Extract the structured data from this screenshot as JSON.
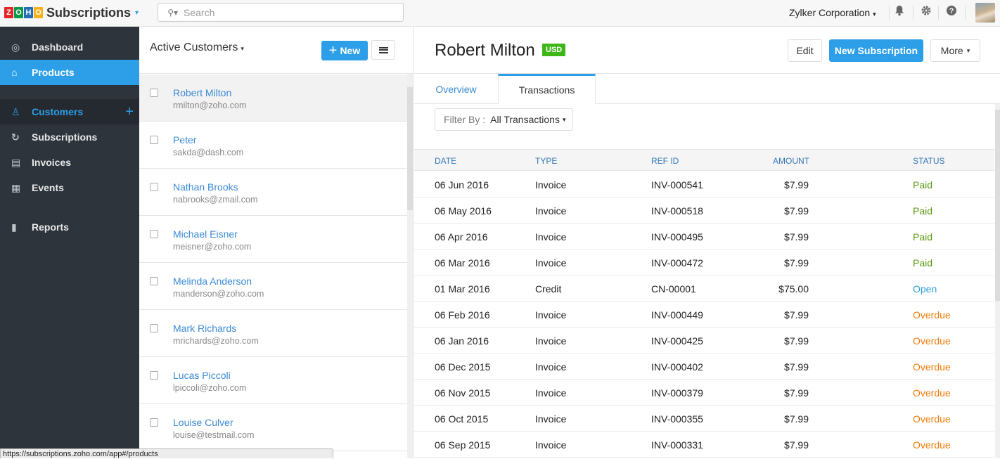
{
  "app": {
    "brand_letters": [
      "Z",
      "O",
      "H",
      "O"
    ],
    "brand_colors": [
      "#e42527",
      "#089949",
      "#226db4",
      "#f9b21d"
    ],
    "name": "Subscriptions",
    "caret": "▾"
  },
  "search": {
    "placeholder": "Search",
    "icon": "search-icon"
  },
  "topbar": {
    "organization": "Zylker Corporation",
    "caret": "▾",
    "icons": {
      "bell": "🔔",
      "gear": "⚙",
      "help": "?"
    }
  },
  "sidebar": {
    "items": [
      {
        "label": "Dashboard",
        "icon": "◎"
      },
      {
        "label": "Products",
        "icon": "⌂"
      },
      {
        "label": "Customers",
        "icon": "♙",
        "action": "+"
      },
      {
        "label": "Subscriptions",
        "icon": "↻"
      },
      {
        "label": "Invoices",
        "icon": "▤"
      },
      {
        "label": "Events",
        "icon": "▦"
      },
      {
        "label": "Reports",
        "icon": "▮"
      }
    ]
  },
  "customer_list": {
    "title": "Active Customers",
    "caret": "▾",
    "new_label": "New",
    "new_icon": "+",
    "customers": [
      {
        "name": "Robert Milton",
        "email": "rmilton@zoho.com"
      },
      {
        "name": "Peter",
        "email": "sakda@dash.com"
      },
      {
        "name": "Nathan Brooks",
        "email": "nabrooks@zmail.com"
      },
      {
        "name": "Michael Eisner",
        "email": "meisner@zoho.com"
      },
      {
        "name": "Melinda Anderson",
        "email": "manderson@zoho.com"
      },
      {
        "name": "Mark Richards",
        "email": "mrichards@zoho.com"
      },
      {
        "name": "Lucas Piccoli",
        "email": "lpiccoli@zoho.com"
      },
      {
        "name": "Louise Culver",
        "email": "louise@testmail.com"
      }
    ]
  },
  "detail": {
    "customer_name": "Robert Milton",
    "currency_badge": "USD",
    "buttons": {
      "edit": "Edit",
      "new_subscription": "New Subscription",
      "more": "More",
      "caret": "▾"
    },
    "tabs": [
      {
        "label": "Overview"
      },
      {
        "label": "Transactions"
      }
    ],
    "filter": {
      "label": "Filter By :",
      "value": "All Transactions",
      "caret": "▾"
    },
    "table": {
      "columns": [
        "DATE",
        "TYPE",
        "REF ID",
        "AMOUNT",
        "STATUS"
      ],
      "rows": [
        {
          "date": "06 Jun 2016",
          "type": "Invoice",
          "ref": "INV-000541",
          "amount": "$7.99",
          "status": "Paid"
        },
        {
          "date": "06 May 2016",
          "type": "Invoice",
          "ref": "INV-000518",
          "amount": "$7.99",
          "status": "Paid"
        },
        {
          "date": "06 Apr 2016",
          "type": "Invoice",
          "ref": "INV-000495",
          "amount": "$7.99",
          "status": "Paid"
        },
        {
          "date": "06 Mar 2016",
          "type": "Invoice",
          "ref": "INV-000472",
          "amount": "$7.99",
          "status": "Paid"
        },
        {
          "date": "01 Mar 2016",
          "type": "Credit",
          "ref": "CN-00001",
          "amount": "$75.00",
          "status": "Open"
        },
        {
          "date": "06 Feb 2016",
          "type": "Invoice",
          "ref": "INV-000449",
          "amount": "$7.99",
          "status": "Overdue"
        },
        {
          "date": "06 Jan 2016",
          "type": "Invoice",
          "ref": "INV-000425",
          "amount": "$7.99",
          "status": "Overdue"
        },
        {
          "date": "06 Dec 2015",
          "type": "Invoice",
          "ref": "INV-000402",
          "amount": "$7.99",
          "status": "Overdue"
        },
        {
          "date": "06 Nov 2015",
          "type": "Invoice",
          "ref": "INV-000379",
          "amount": "$7.99",
          "status": "Overdue"
        },
        {
          "date": "06 Oct 2015",
          "type": "Invoice",
          "ref": "INV-000355",
          "amount": "$7.99",
          "status": "Overdue"
        },
        {
          "date": "06 Sep 2015",
          "type": "Invoice",
          "ref": "INV-000331",
          "amount": "$7.99",
          "status": "Overdue"
        }
      ]
    }
  },
  "status_colors": {
    "Paid": "#5a9a10",
    "Open": "#2c9fd8",
    "Overdue": "#f07b0a"
  },
  "status_bar_url": "https://subscriptions.zoho.com/app#/products"
}
